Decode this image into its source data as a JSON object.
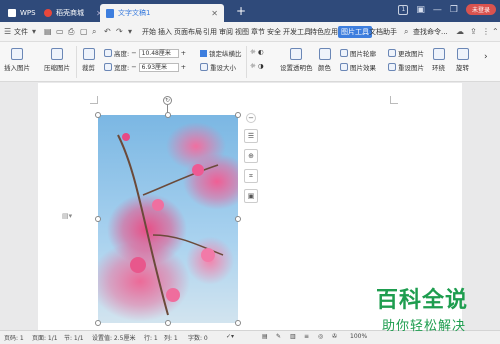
{
  "titlebar": {
    "tabs": [
      {
        "label": "WPS",
        "icon": "wps-logo-icon"
      },
      {
        "label": "稻壳商城",
        "icon": "shop-icon"
      },
      {
        "label": "文字文稿1",
        "icon": "doc-icon"
      }
    ],
    "page_count": "1",
    "login_label": "未登录"
  },
  "menubar": {
    "file_label": "文件",
    "items": [
      "开始",
      "插入",
      "页面布局",
      "引用",
      "审阅",
      "视图",
      "章节",
      "安全",
      "开发工具",
      "特色应用",
      "图片工具",
      "文档助手"
    ],
    "active_item": "图片工具",
    "search_label": "查找命令..."
  },
  "ribbon": {
    "insert_picture": "插入图片",
    "compress_picture": "压缩图片",
    "crop": "裁剪",
    "height_label": "高度:",
    "height_value": "10.48厘米",
    "width_label": "宽度:",
    "width_value": "6.93厘米",
    "lock_ratio": "锁定纵横比",
    "reset_size": "重设大小",
    "set_transparent": "设置透明色",
    "color": "颜色",
    "picture_outline": "图片轮廓",
    "picture_effect": "图片效果",
    "change_picture": "更改图片",
    "reset_picture": "重设图片",
    "wrap": "环绕",
    "rotate": "旋转"
  },
  "statusbar": {
    "page": "页码: 1",
    "pages": "页面: 1/1",
    "section": "节: 1/1",
    "setting": "设置值: 2.5厘米",
    "row": "行: 1",
    "col": "列: 1",
    "words": "字数: 0",
    "zoom": "100%"
  },
  "watermark": {
    "title": "百科全说",
    "subtitle": "助你轻松解决"
  }
}
